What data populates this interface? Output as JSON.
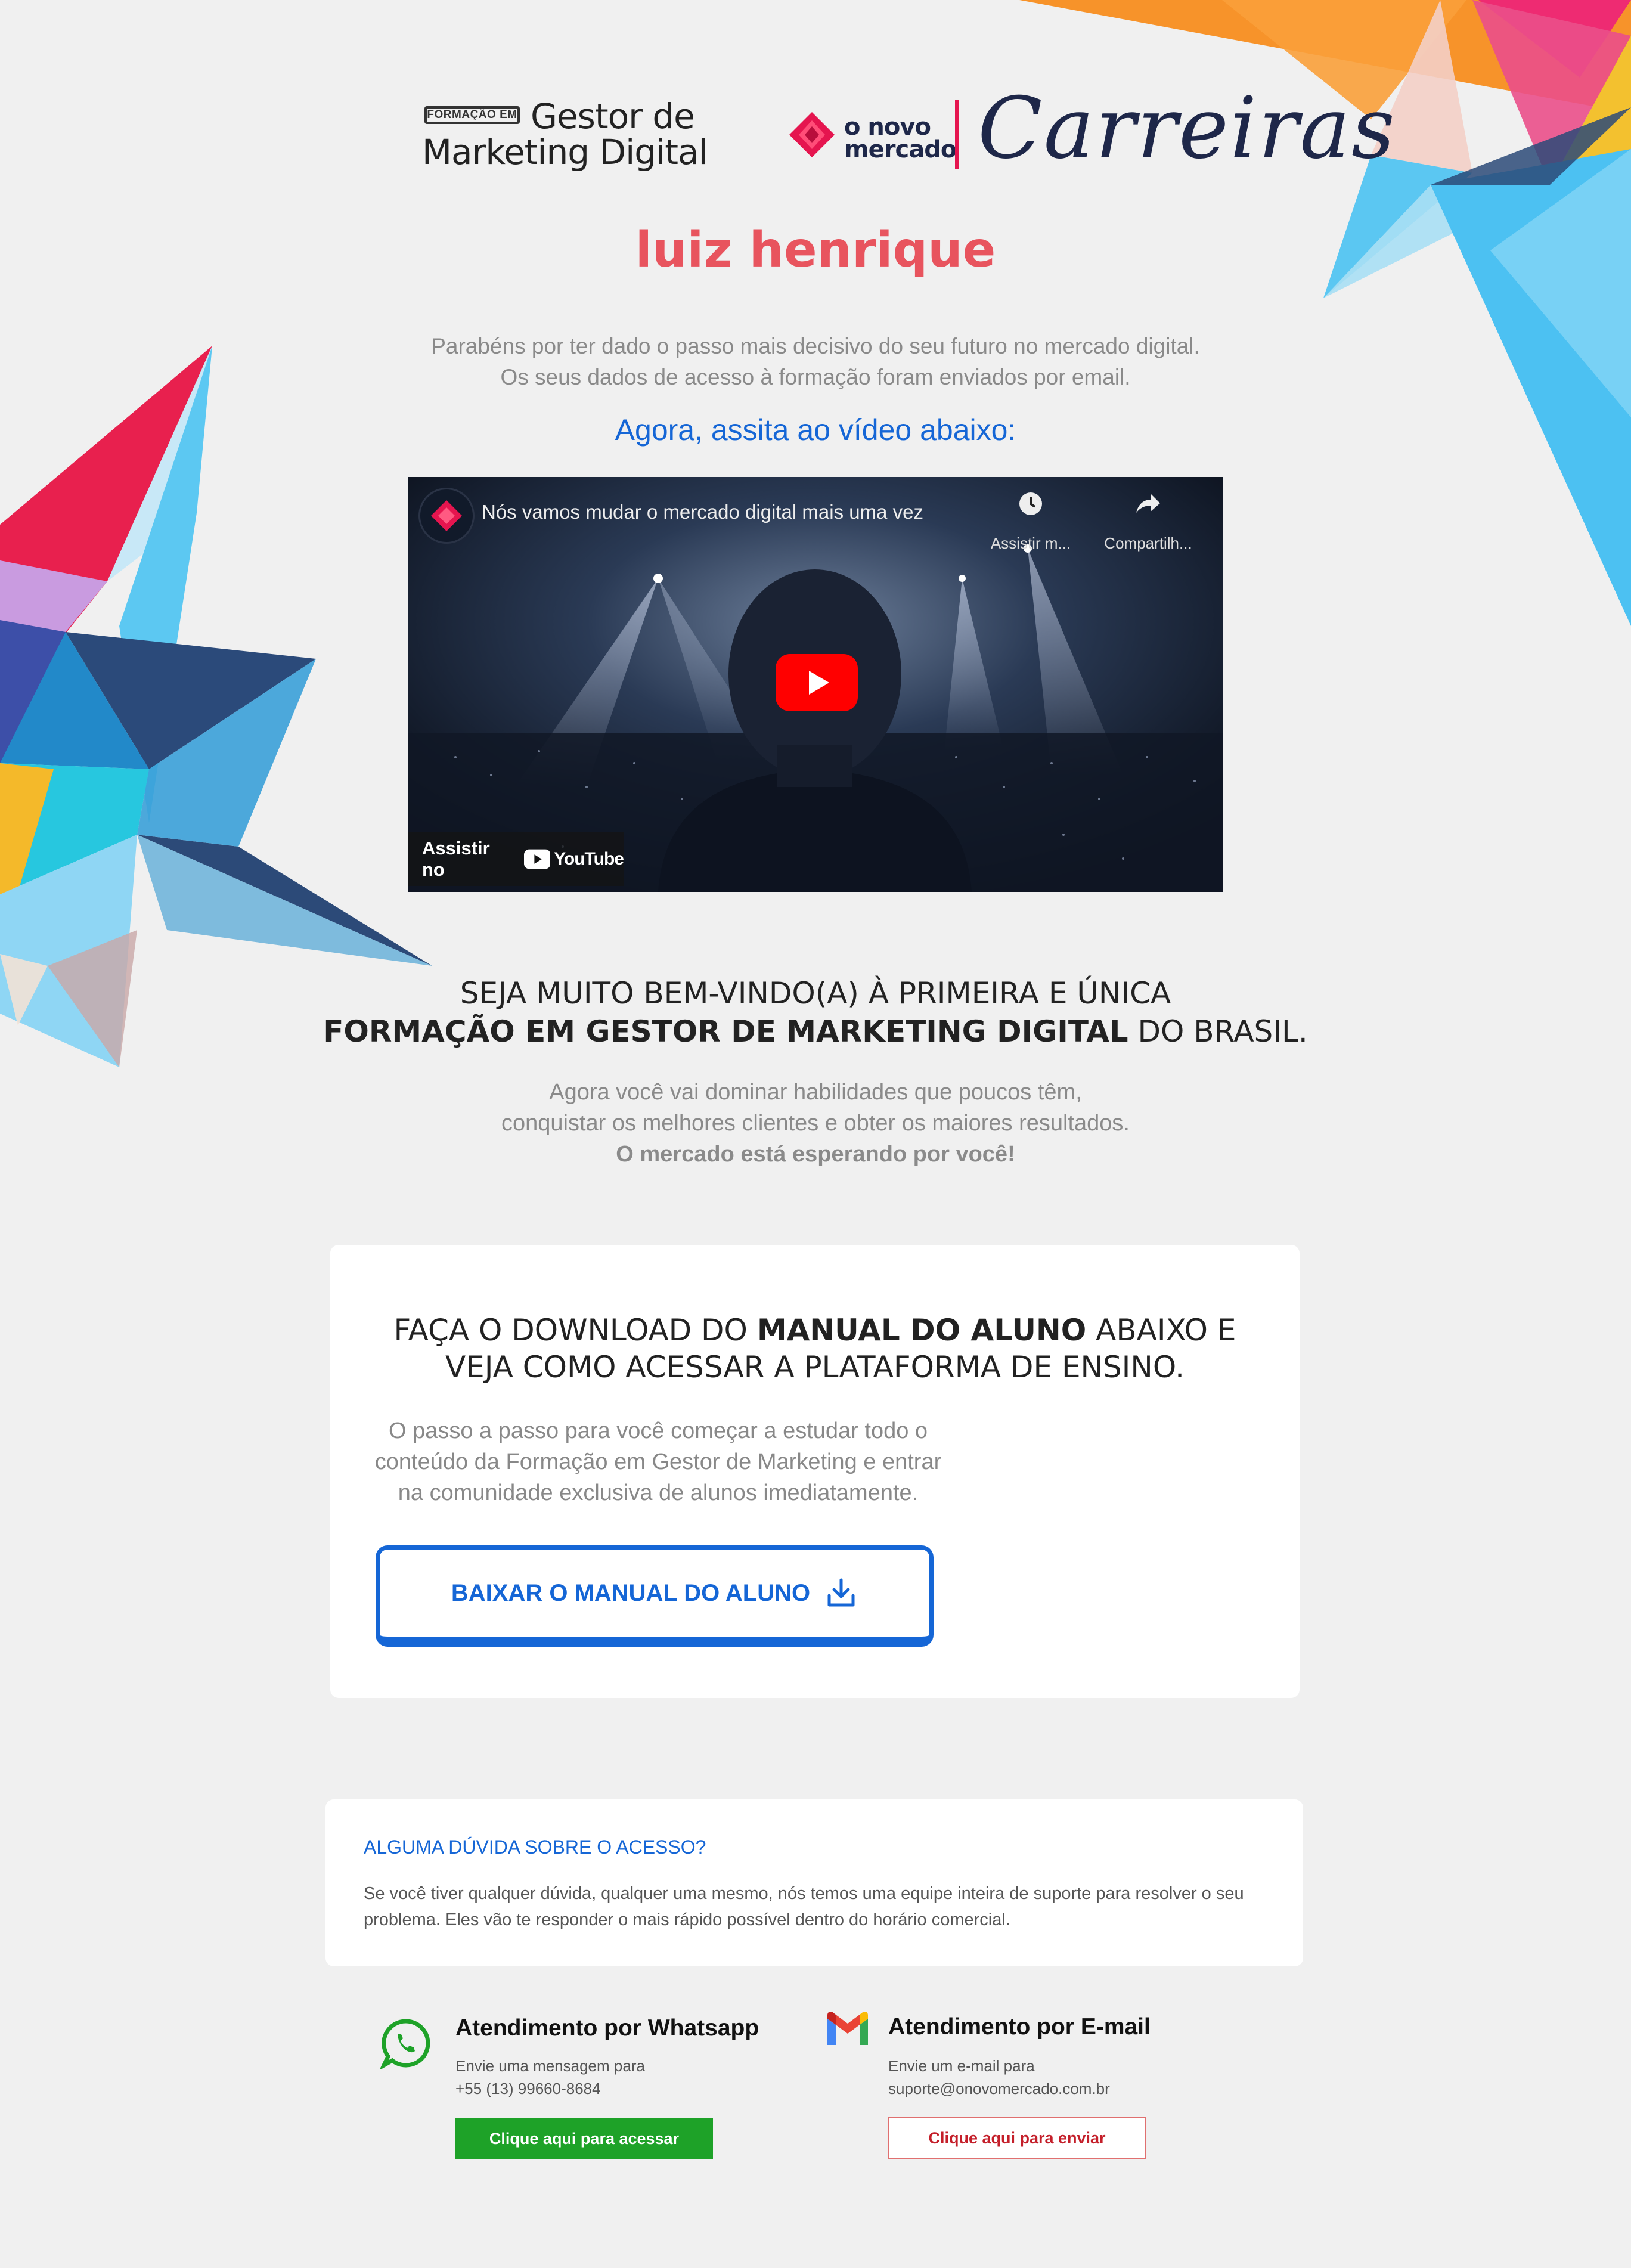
{
  "header": {
    "badge": "FORMAÇÃO EM",
    "course_line1": "Gestor de",
    "course_line2": "Marketing Digital",
    "brand_line1": "o novo",
    "brand_line2": "mercado",
    "carreiras": "Carreiras"
  },
  "hero": {
    "name": "luiz henrique",
    "congrats_line1": "Parabéns por ter dado o passo mais decisivo do seu futuro no mercado digital.",
    "congrats_line2": "Os seus dados de acesso à formação foram enviados por email.",
    "watch_prompt": "Agora, assita ao vídeo abaixo:"
  },
  "video": {
    "title": "Nós vamos mudar o mercado digital mais uma vez",
    "watch_later": "Assistir m...",
    "share": "Compartilh...",
    "watch_on": "Assistir no",
    "youtube": "YouTube"
  },
  "welcome": {
    "line1": "SEJA MUITO BEM-VINDO(A) À PRIMEIRA E ÚNICA",
    "line2_bold": "FORMAÇÃO EM GESTOR DE MARKETING DIGITAL",
    "line2_rest": " DO BRASIL.",
    "p_line1": "Agora você vai dominar habilidades que poucos têm,",
    "p_line2": "conquistar os melhores clientes e obter os maiores resultados.",
    "p_line3_bold": "O mercado está esperando por você!"
  },
  "manual_card": {
    "title_pre": "FAÇA O DOWNLOAD DO ",
    "title_bold": "MANUAL DO ALUNO",
    "title_post": " ABAIXO E",
    "title_line2": "VEJA COMO ACESSAR A PLATAFORMA DE ENSINO.",
    "p_line1": "O passo a passo para você começar a estudar todo o",
    "p_line2": "conteúdo da Formação em Gestor de Marketing e entrar",
    "p_line3": "na comunidade exclusiva de alunos imediatamente.",
    "button_label": "BAIXAR O MANUAL DO ALUNO"
  },
  "faq": {
    "title": "ALGUMA DÚVIDA SOBRE O ACESSO?",
    "text": "Se você tiver qualquer dúvida, qualquer uma mesmo, nós temos uma equipe inteira de suporte para resolver o seu problema. Eles vão te responder o mais rápido possível dentro do horário comercial."
  },
  "contacts": {
    "whatsapp": {
      "title": "Atendimento por Whatsapp",
      "text_line1": "Envie uma mensagem para",
      "text_line2": "+55 (13) 99660-8684",
      "button": "Clique aqui para acessar"
    },
    "email": {
      "title": "Atendimento por E-mail",
      "text_line1": "Envie um e-mail para",
      "text_line2": "suporte@onovomercado.com.br",
      "button": "Clique aqui para enviar"
    }
  },
  "colors": {
    "accent_blue": "#1566d6",
    "brand_red": "#e5154f",
    "name_red": "#e8545e",
    "whatsapp_green": "#1ea228"
  },
  "icons": [
    "brand-diamond-icon",
    "youtube-play-icon",
    "clock-icon",
    "share-icon",
    "youtube-logo-icon",
    "download-icon",
    "whatsapp-icon",
    "gmail-icon"
  ]
}
